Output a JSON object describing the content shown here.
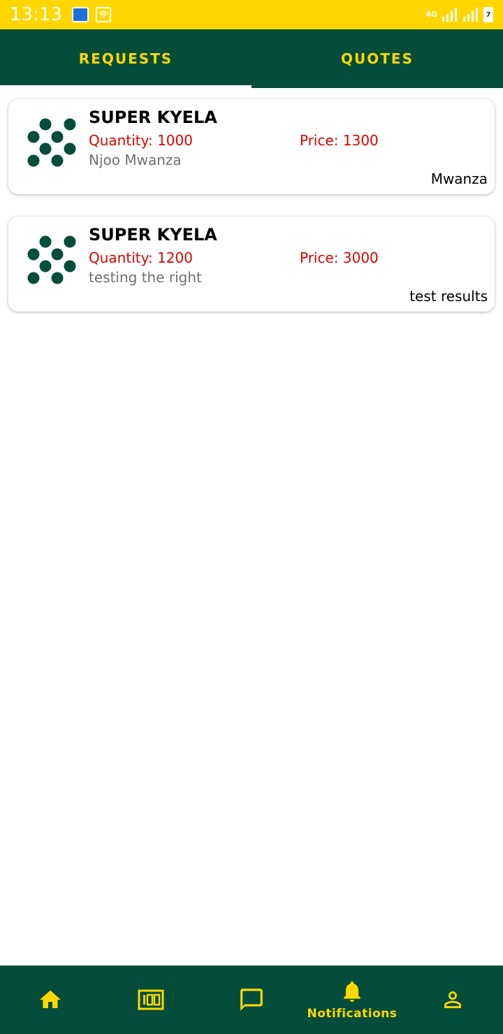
{
  "status_bar": {
    "time": "13:13",
    "network": "4G",
    "battery": "7"
  },
  "tabs": [
    {
      "label": "REQUESTS",
      "active": true
    },
    {
      "label": "QUOTES",
      "active": false
    }
  ],
  "requests": [
    {
      "title": "SUPER KYELA",
      "quantity": "Quantity: 1000",
      "price": "Price: 1300",
      "description": "Njoo Mwanza",
      "location": "Mwanza"
    },
    {
      "title": "SUPER KYELA",
      "quantity": "Quantity: 1200",
      "price": "Price: 3000",
      "description": "testing the right",
      "location": "test results"
    }
  ],
  "bottom_nav": [
    {
      "icon": "home-icon",
      "label": ""
    },
    {
      "icon": "counter-icon",
      "label": ""
    },
    {
      "icon": "chat-icon",
      "label": ""
    },
    {
      "icon": "bell-icon",
      "label": "Notifications",
      "active": true
    },
    {
      "icon": "person-icon",
      "label": ""
    }
  ],
  "colors": {
    "primary": "#034d3a",
    "accent": "#FFD700",
    "price_red": "#e00000"
  }
}
